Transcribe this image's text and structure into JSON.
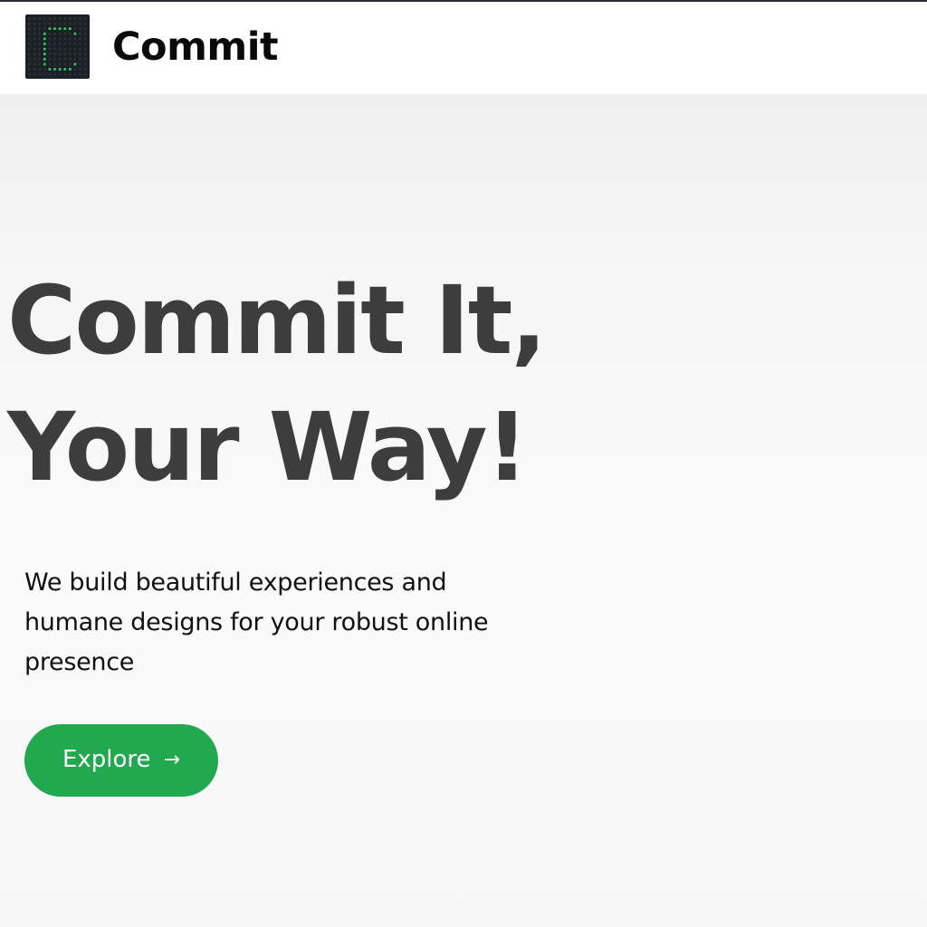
{
  "header": {
    "logo_icon": "commit-logo-icon",
    "brand_name": "Commit"
  },
  "hero": {
    "title_line1": "Commit It,",
    "title_line2": "Your Way!",
    "subtitle": "We build beautiful experiences and humane designs for your robust online presence",
    "cta_label": "Explore",
    "cta_icon": "arrow-right-icon",
    "cta_arrow": "→"
  },
  "colors": {
    "accent": "#22a94f",
    "logo_bg": "#1b1f26",
    "logo_dots": "#34c759",
    "title": "#3d3d3d",
    "text": "#111111"
  }
}
